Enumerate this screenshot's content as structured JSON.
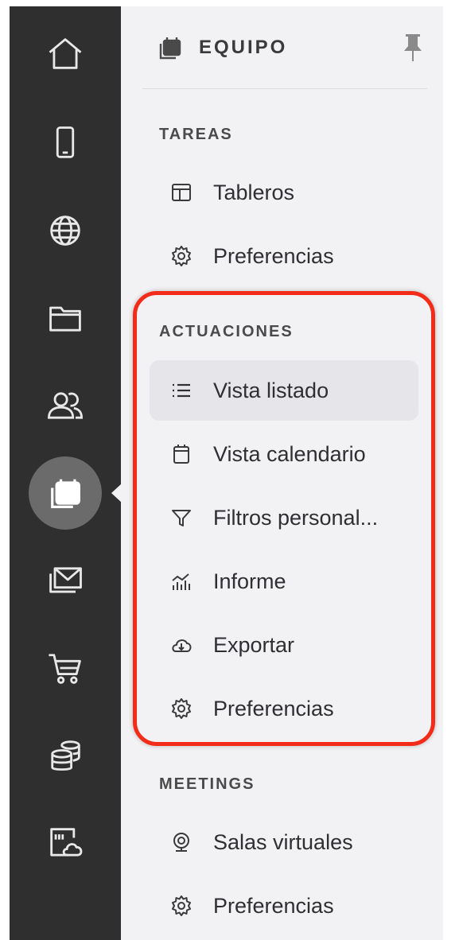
{
  "rail": {
    "items": [
      {
        "icon": "home-icon"
      },
      {
        "icon": "mobile-icon"
      },
      {
        "icon": "globe-icon"
      },
      {
        "icon": "folder-icon"
      },
      {
        "icon": "users-icon"
      },
      {
        "icon": "team-calendar-icon",
        "active": true
      },
      {
        "icon": "mail-stack-icon"
      },
      {
        "icon": "cart-icon"
      },
      {
        "icon": "database-icon"
      },
      {
        "icon": "cloud-app-icon"
      }
    ]
  },
  "panel": {
    "title": "EQUIPO",
    "sections": [
      {
        "title": "TAREAS",
        "items": [
          {
            "label": "Tableros",
            "icon": "board-icon"
          },
          {
            "label": "Preferencias",
            "icon": "gear-icon"
          }
        ]
      },
      {
        "title": "ACTUACIONES",
        "items": [
          {
            "label": "Vista listado",
            "icon": "list-icon",
            "selected": true
          },
          {
            "label": "Vista calendario",
            "icon": "calendar-icon"
          },
          {
            "label": "Filtros personal...",
            "icon": "filter-icon"
          },
          {
            "label": "Informe",
            "icon": "report-chart-icon"
          },
          {
            "label": "Exportar",
            "icon": "cloud-download-icon"
          },
          {
            "label": "Preferencias",
            "icon": "gear-icon"
          }
        ]
      },
      {
        "title": "MEETINGS",
        "items": [
          {
            "label": "Salas virtuales",
            "icon": "webcam-icon"
          },
          {
            "label": "Preferencias",
            "icon": "gear-icon"
          }
        ]
      }
    ]
  },
  "colors": {
    "rail_bg": "#2f2f2f",
    "panel_bg": "#f2f2f4",
    "highlight": "#f22c19",
    "selected_bg": "#e6e6ea"
  }
}
